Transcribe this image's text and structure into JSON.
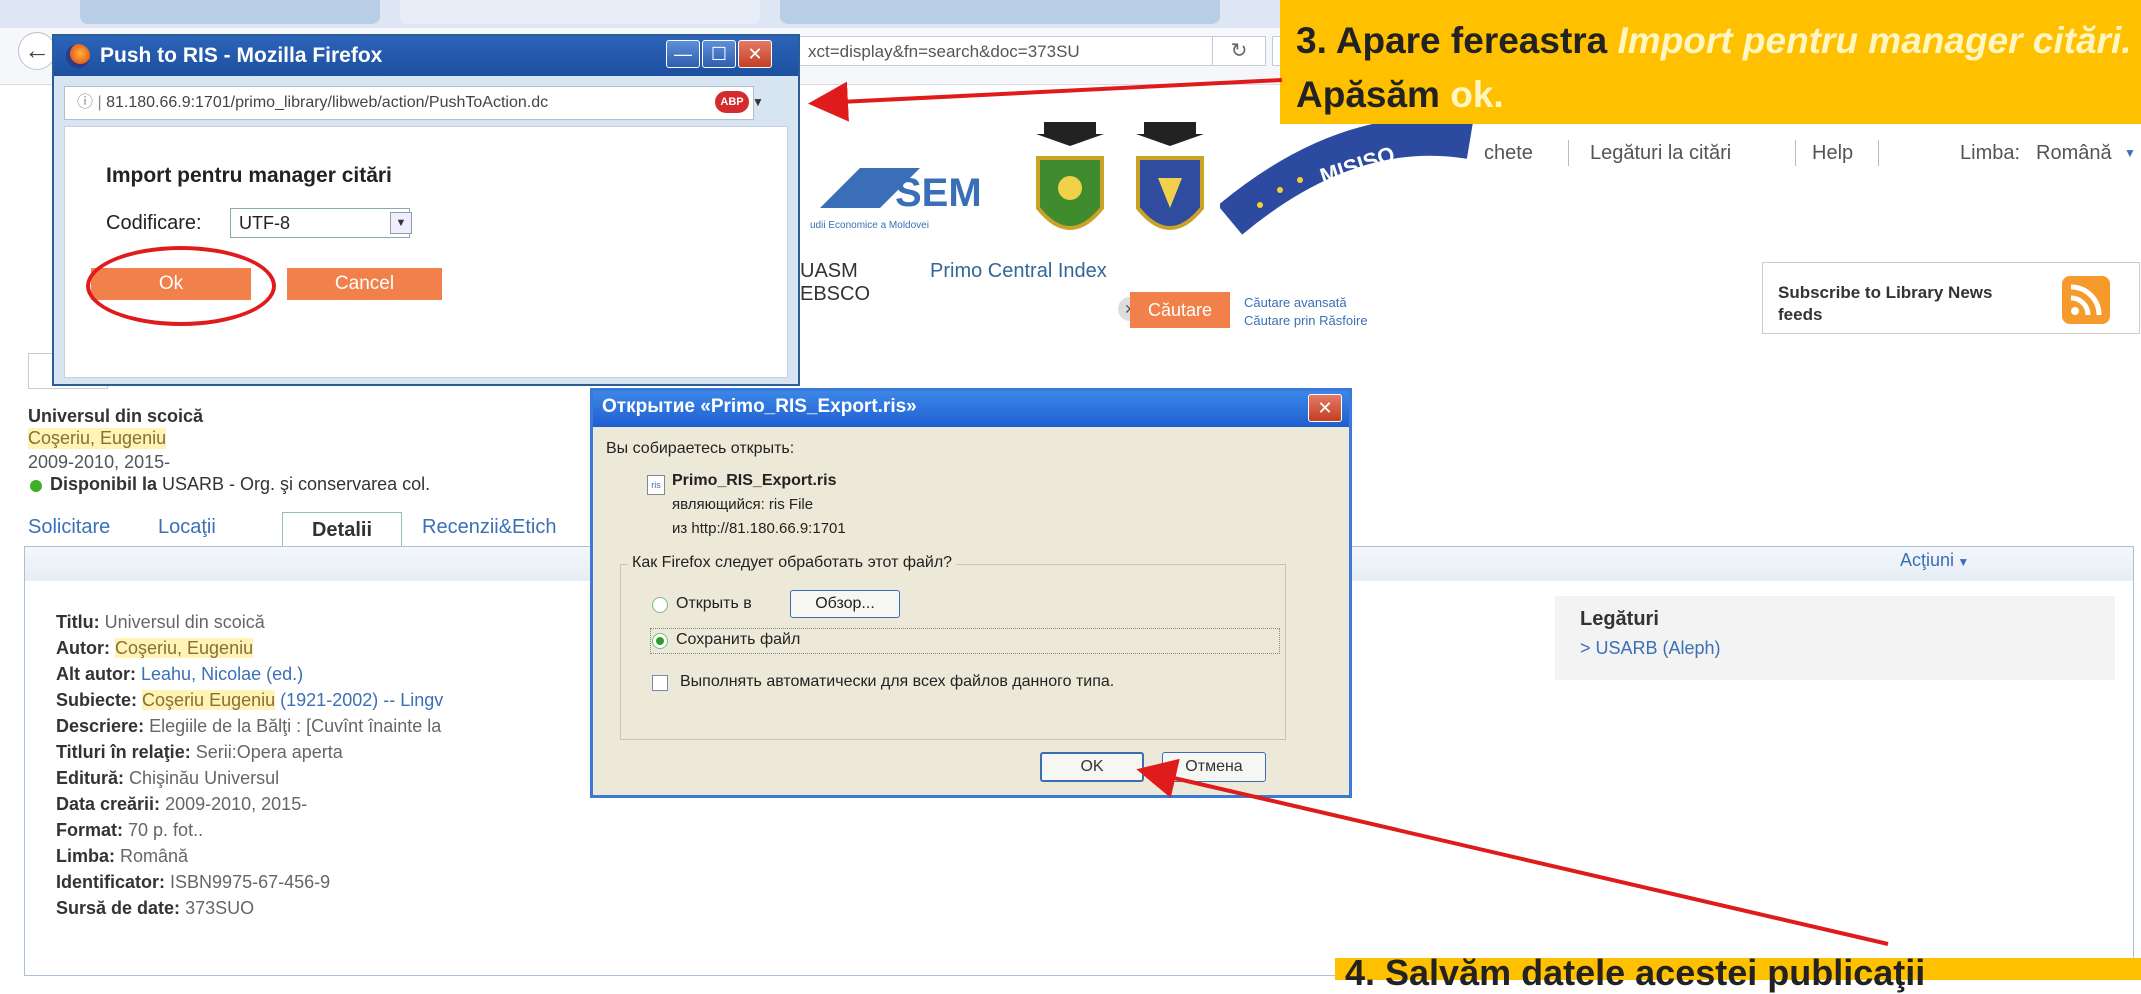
{
  "browser": {
    "url_fragment": "xct=display&fn=search&doc=373SU",
    "reload_icon": "reload-icon"
  },
  "page": {
    "toplinks": [
      "chete",
      "Legături la citări",
      "Help",
      "Limba:",
      "Română"
    ],
    "logo_text": "SEM",
    "logo_subtitle": "udii Economice a Moldovei",
    "seal_text": "MISISO",
    "scopes": [
      "UASM",
      "Primo Central Index",
      "EBSCO"
    ],
    "search_button": "Căutare",
    "advanced_search": "Căutare avansată",
    "browse_search": "Căutare prin Răsfoire",
    "rss_text": "Subscribe to Library News feeds",
    "record": {
      "title": "Universul din scoică",
      "author": "Coşeriu, Eugeniu",
      "years": "2009-2010, 2015-",
      "availability_label": "Disponibil la",
      "availability_value": "USARB - Org. şi conservarea col."
    },
    "tabs": [
      "Solicitare",
      "Locaţii",
      "Detalii",
      "Recenzii&Etich"
    ],
    "actions_label": "Acţiuni",
    "details": [
      {
        "label": "Titlu:",
        "value": "Universul din scoică"
      },
      {
        "label": "Autor:",
        "value": "Coşeriu, Eugeniu"
      },
      {
        "label": "Alt autor:",
        "value": "Leahu, Nicolae (ed.)"
      },
      {
        "label": "Subiecte:",
        "value": "Coşeriu Eugeniu",
        "value_extra": "(1921-2002) -- Lingv"
      },
      {
        "label": "Descriere:",
        "value": "Elegiile de la Bălţi : [Cuvînt înainte la"
      },
      {
        "label": "Titluri în relaţie:",
        "value": "Serii:Opera aperta"
      },
      {
        "label": "Editură:",
        "value": "Chişinău Universul"
      },
      {
        "label": "Data creării:",
        "value": "2009-2010, 2015-"
      },
      {
        "label": "Format:",
        "value": "70 p. fot.."
      },
      {
        "label": "Limba:",
        "value": "Română"
      },
      {
        "label": "Identificator:",
        "value": "ISBN9975-67-456-9"
      },
      {
        "label": "Sursă de date:",
        "value": "373SUO"
      }
    ],
    "links_title": "Legături",
    "links_item": "> USARB (Aleph)"
  },
  "dialog1": {
    "title": "Push to RIS - Mozilla Firefox",
    "url": "81.180.66.9:1701/primo_library/libweb/action/PushToAction.dc",
    "abp": "ABP",
    "heading": "Import pentru manager citări",
    "encoding_label": "Codificare:",
    "encoding_value": "UTF-8",
    "ok": "Ok",
    "cancel": "Cancel"
  },
  "dialog2": {
    "title": "Открытие «Primo_RIS_Export.ris»",
    "intro": "Вы собираетесь открыть:",
    "filename": "Primo_RIS_Export.ris",
    "type_line": "являющийся: ris File",
    "from_line": "из http://81.180.66.9:1701",
    "group_label": "Как Firefox следует обработать этот файл?",
    "open_with": "Открыть в",
    "browse": "Обзор...",
    "save_file": "Сохранить файл",
    "auto": "Выполнять автоматически для всех файлов данного типа.",
    "ok": "OK",
    "cancel": "Отмена"
  },
  "callout3": {
    "prefix": "3. Apare fereastra ",
    "highlight": "Import pentru manager citări.",
    "middle": " Apăsăm ",
    "ok_word": "ok."
  },
  "callout4": {
    "text": "4. Salvăm datele acestei publicaţii"
  },
  "colors": {
    "callout": "#ffc000",
    "button_orange": "#f2804a",
    "annotation_red": "#e01b1b",
    "link_blue": "#3b6fb6"
  }
}
